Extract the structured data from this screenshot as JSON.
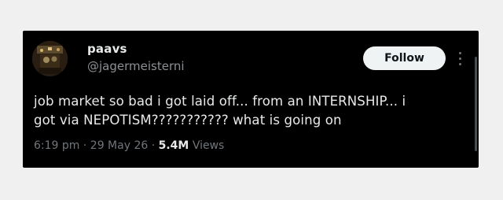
{
  "user": {
    "display_name": "paavs",
    "handle": "@jagermeisterni"
  },
  "follow_button_label": "Follow",
  "tweet": {
    "text_line1": "job market so bad i got laid off... from an INTERNSHIP... i",
    "text_line2": "got via NEPOTISM??????????? what is going on"
  },
  "meta": {
    "time": "6:19 pm",
    "separator": "·",
    "date": "29 May 26",
    "views_count": "5.4M",
    "views_label": "Views"
  },
  "icons": {
    "avatar": "profile-photo",
    "more": "more-vertical-icon"
  },
  "colors": {
    "background": "#000000",
    "primary_text": "#e7e9ea",
    "secondary_text": "#71767b",
    "follow_button_bg": "#eff3f4"
  }
}
